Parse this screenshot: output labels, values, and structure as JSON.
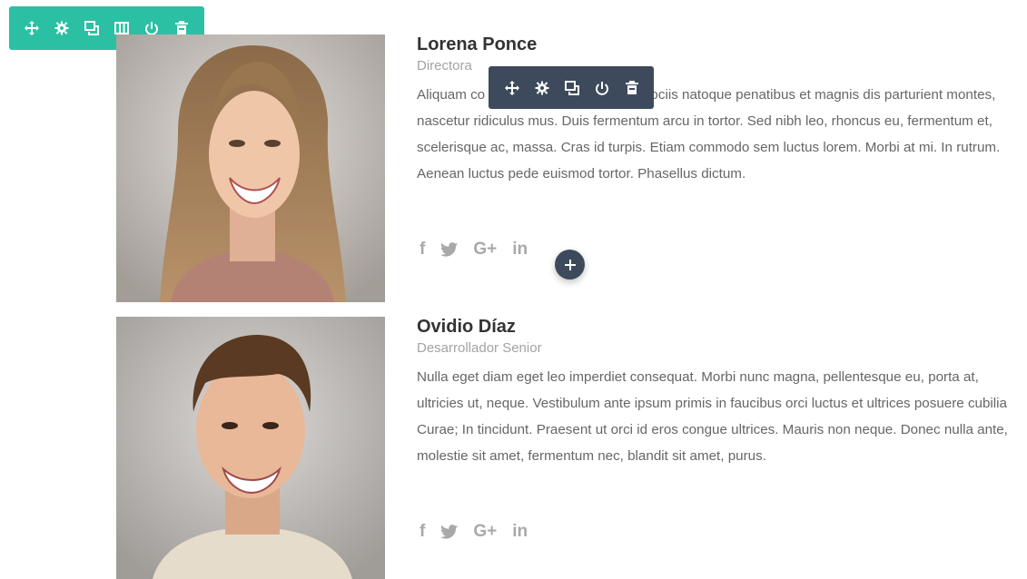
{
  "members": [
    {
      "name": "Lorena Ponce",
      "role": "Directora",
      "bio": "Aliquam co              m. In diam. Cum sociis natoque penatibus et magnis dis parturient montes, nascetur ridiculus mus. Duis fermentum arcu in tortor. Sed nibh leo, rhoncus eu, fermentum et, scelerisque ac, massa. Cras id turpis. Etiam commodo sem luctus lorem. Morbi at mi. In rutrum. Aenean luctus pede euismod tortor. Phasellus dictum.",
      "social": {
        "facebook": "f",
        "google": "G+",
        "linkedin": "in"
      }
    },
    {
      "name": "Ovidio Díaz",
      "role": "Desarrollador Senior",
      "bio": "Nulla eget diam eget leo imperdiet consequat. Morbi nunc magna, pellentesque eu, porta at, ultricies ut, neque. Vestibulum ante ipsum primis in faucibus orci luctus et ultrices posuere cubilia Curae; In tincidunt. Praesent ut orci id eros congue ultrices. Mauris non neque. Donec nulla ante, molestie sit amet, fermentum nec, blandit sit amet, purus.",
      "social": {
        "facebook": "f",
        "google": "G+",
        "linkedin": "in"
      }
    }
  ],
  "section_toolbar": {
    "color": "#2bc0a3",
    "icons": [
      "move-icon",
      "settings-icon",
      "duplicate-icon",
      "columns-icon",
      "save-icon",
      "delete-icon"
    ]
  },
  "module_toolbar": {
    "color": "#3d4a5b",
    "icons": [
      "move-icon",
      "settings-icon",
      "duplicate-icon",
      "save-icon",
      "delete-icon"
    ]
  },
  "add_button": {
    "icon": "plus-icon"
  }
}
